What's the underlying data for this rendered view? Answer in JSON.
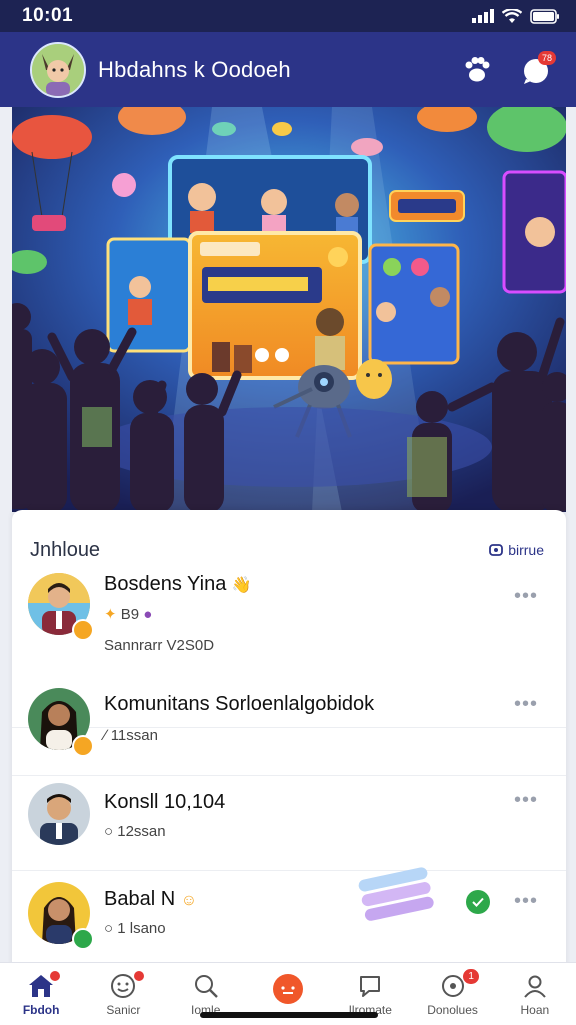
{
  "status_bar": {
    "time": "10:01"
  },
  "header": {
    "title": "Hbdahns k Oodoeh",
    "notification_count": "78"
  },
  "feed": {
    "title": "Jnhloue",
    "link_label": "birrue",
    "items": [
      {
        "name": "Bosdens Yina",
        "sub": "B9",
        "extra": "Sannrarr V2S0D",
        "badge_color": "#f5a623"
      },
      {
        "name": "Komunitans Sorloenlalgobidok",
        "sub": "11ssan",
        "extra": "",
        "badge_color": "#f5a623"
      },
      {
        "name": "Konsll 10,104",
        "sub": "12ssan",
        "extra": "",
        "badge_color": ""
      },
      {
        "name": "Babal N",
        "sub": "1 lsano",
        "extra": "",
        "badge_color": "#2da84a"
      }
    ]
  },
  "bottom_nav": {
    "items": [
      {
        "label": "Fbdoh",
        "icon": "home-icon"
      },
      {
        "label": "Sanicr",
        "icon": "emoji-icon"
      },
      {
        "label": "Iomle",
        "icon": "search-icon"
      },
      {
        "label": "",
        "icon": "create-icon"
      },
      {
        "label": "Ilromate",
        "icon": "chat-icon"
      },
      {
        "label": "Donolues",
        "icon": "notification-icon",
        "badge": "1"
      },
      {
        "label": "Hoan",
        "icon": "profile-icon"
      }
    ]
  },
  "colors": {
    "header_bg": "#2c3488",
    "status_bg": "#1d2353",
    "accent_red": "#e53935",
    "accent_green": "#2da84a",
    "create_orange": "#f0572a"
  }
}
